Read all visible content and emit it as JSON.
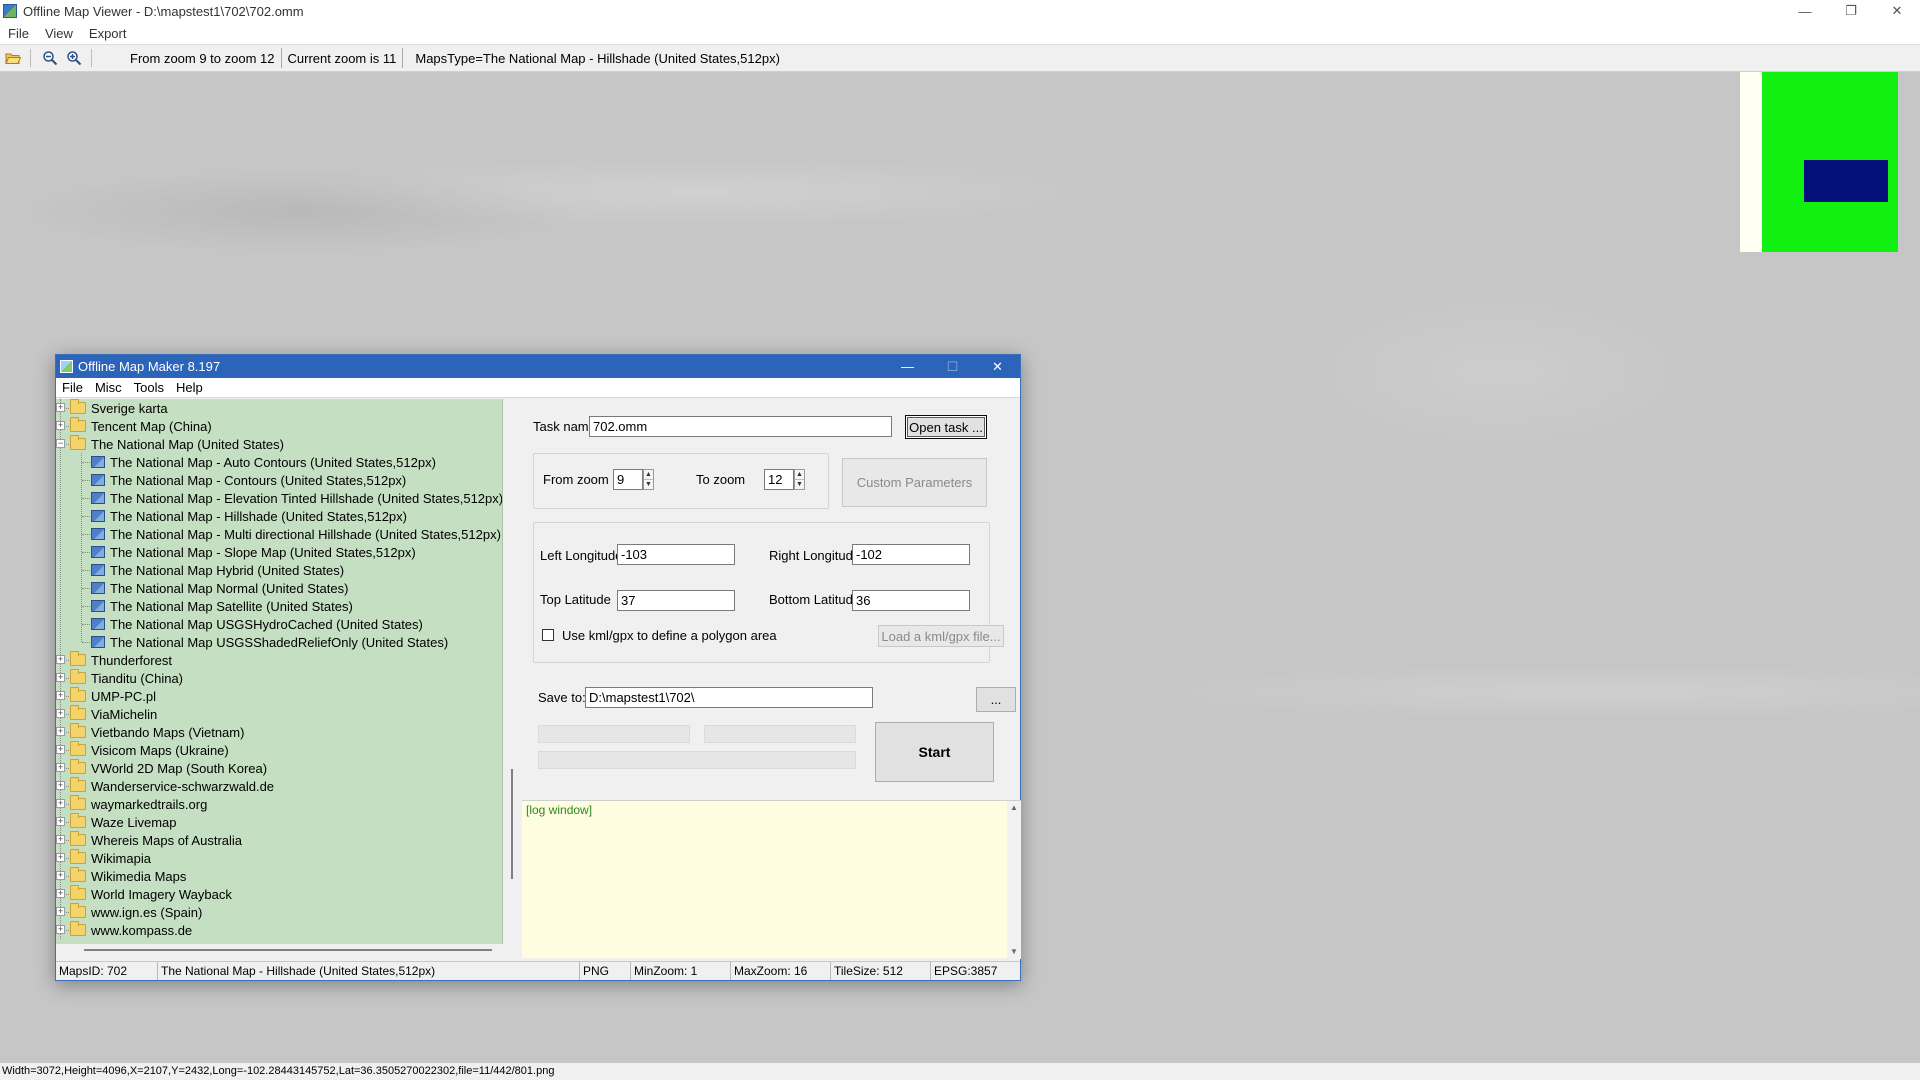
{
  "window": {
    "title": "Offline Map Viewer - D:\\mapstest1\\702\\702.omm",
    "controls": {
      "minimize": "—",
      "restore": "❐",
      "close": "✕"
    }
  },
  "menu": [
    "File",
    "View",
    "Export"
  ],
  "toolbar": {
    "icons": [
      "open-folder-icon",
      "zoom-out-icon",
      "zoom-in-icon"
    ],
    "zoom_range": "From zoom 9 to zoom 12",
    "current_zoom": "Current zoom is 11",
    "maps_type": "MapsType=The National Map - Hillshade (United States,512px)"
  },
  "status_bar": {
    "text": "Width=3072,Height=4096,X=2107,Y=2432,Long=-102.28443145752,Lat=36.3505270022302,file=11/442/801.png"
  },
  "colors": {
    "overview_bg": "#fffff2",
    "overview_green": "#12f012",
    "overview_viewport": "#06107a",
    "map_gray": "#c6c6c6",
    "tree_bg": "#c4dfc1",
    "dialog_title": "#2b64b8",
    "log_bg": "#fffde0"
  },
  "dialog": {
    "title": "Offline Map Maker 8.197",
    "controls": {
      "minimize": "—",
      "maximize": "☐",
      "close": "✕"
    },
    "menu": [
      "File",
      "Misc",
      "Tools",
      "Help"
    ],
    "tree": [
      {
        "label": "Sverige karta",
        "level": 0,
        "type": "folder",
        "expander": "+"
      },
      {
        "label": "Tencent Map (China)",
        "level": 0,
        "type": "folder",
        "expander": "+"
      },
      {
        "label": "The National Map (United States)",
        "level": 0,
        "type": "folder-open",
        "expander": "−"
      },
      {
        "label": "The National Map - Auto Contours (United States,512px)",
        "level": 1,
        "type": "map"
      },
      {
        "label": "The National Map - Contours (United States,512px)",
        "level": 1,
        "type": "map"
      },
      {
        "label": "The National Map - Elevation Tinted Hillshade (United States,512px)",
        "level": 1,
        "type": "map"
      },
      {
        "label": "The National Map - Hillshade (United States,512px)",
        "level": 1,
        "type": "map"
      },
      {
        "label": "The National Map - Multi directional Hillshade (United States,512px)",
        "level": 1,
        "type": "map"
      },
      {
        "label": "The National Map - Slope Map (United States,512px)",
        "level": 1,
        "type": "map"
      },
      {
        "label": "The National Map Hybrid (United States)",
        "level": 1,
        "type": "map"
      },
      {
        "label": "The National Map Normal (United States)",
        "level": 1,
        "type": "map"
      },
      {
        "label": "The National Map Satellite (United States)",
        "level": 1,
        "type": "map"
      },
      {
        "label": "The National Map USGSHydroCached (United States)",
        "level": 1,
        "type": "map"
      },
      {
        "label": "The National Map USGSShadedReliefOnly (United States)",
        "level": 1,
        "type": "map"
      },
      {
        "label": "Thunderforest",
        "level": 0,
        "type": "folder",
        "expander": "+"
      },
      {
        "label": "Tianditu (China)",
        "level": 0,
        "type": "folder",
        "expander": "+"
      },
      {
        "label": "UMP-PC.pl",
        "level": 0,
        "type": "folder",
        "expander": "+"
      },
      {
        "label": "ViaMichelin",
        "level": 0,
        "type": "folder",
        "expander": "+"
      },
      {
        "label": "Vietbando Maps (Vietnam)",
        "level": 0,
        "type": "folder",
        "expander": "+"
      },
      {
        "label": "Visicom Maps (Ukraine)",
        "level": 0,
        "type": "folder",
        "expander": "+"
      },
      {
        "label": "VWorld 2D Map (South Korea)",
        "level": 0,
        "type": "folder",
        "expander": "+"
      },
      {
        "label": "Wanderservice-schwarzwald.de",
        "level": 0,
        "type": "folder",
        "expander": "+"
      },
      {
        "label": "waymarkedtrails.org",
        "level": 0,
        "type": "folder",
        "expander": "+"
      },
      {
        "label": "Waze Livemap",
        "level": 0,
        "type": "folder",
        "expander": "+"
      },
      {
        "label": "Whereis Maps of Australia",
        "level": 0,
        "type": "folder",
        "expander": "+"
      },
      {
        "label": "Wikimapia",
        "level": 0,
        "type": "folder",
        "expander": "+"
      },
      {
        "label": "Wikimedia Maps",
        "level": 0,
        "type": "folder",
        "expander": "+"
      },
      {
        "label": "World Imagery Wayback",
        "level": 0,
        "type": "folder",
        "expander": "+"
      },
      {
        "label": "www.ign.es (Spain)",
        "level": 0,
        "type": "folder",
        "expander": "+"
      },
      {
        "label": "www.kompass.de",
        "level": 0,
        "type": "folder",
        "expander": "+"
      }
    ],
    "task": {
      "label": "Task name",
      "value": "702.omm",
      "open_button": "Open task ..."
    },
    "zoom": {
      "from_label": "From zoom",
      "from_value": "9",
      "to_label": "To zoom",
      "to_value": "12",
      "custom_button": "Custom Parameters"
    },
    "bounds": {
      "left_label": "Left Longitude",
      "left_value": "-103",
      "right_label": "Right Longitude",
      "right_value": "-102",
      "top_label": "Top Latitude",
      "top_value": "37",
      "bottom_label": "Bottom Latitude",
      "bottom_value": "36",
      "kml_label": "Use kml/gpx to define a polygon area",
      "kml_checked": false,
      "kml_button": "Load a kml/gpx file..."
    },
    "save": {
      "label": "Save to:",
      "value": "D:\\mapstest1\\702\\",
      "browse_button": "..."
    },
    "start_button": "Start",
    "log": "[log window]",
    "status": {
      "maps_id": "MapsID: 702",
      "map_name": "The National Map - Hillshade (United States,512px)",
      "format": "PNG",
      "min_zoom": "MinZoom: 1",
      "max_zoom": "MaxZoom: 16",
      "tile_size": "TileSize: 512",
      "epsg": "EPSG:3857"
    }
  }
}
